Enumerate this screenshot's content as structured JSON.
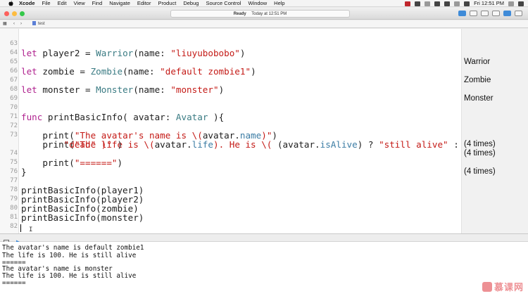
{
  "menubar": {
    "apple": "",
    "app": "Xcode",
    "items": [
      "File",
      "Edit",
      "View",
      "Find",
      "Navigate",
      "Editor",
      "Product",
      "Debug",
      "Source Control",
      "Window",
      "Help"
    ],
    "clock": "Fri 12:51 PM"
  },
  "toolbar": {
    "status_state": "Ready",
    "status_time": "Today at 12:51 PM"
  },
  "jumpbar": {
    "file": "test"
  },
  "editor": {
    "lines": [
      {
        "n": "63",
        "result": "Warrior"
      },
      {
        "n": "64",
        "result": ""
      },
      {
        "n": "65",
        "result": "Zombie"
      },
      {
        "n": "66",
        "result": ""
      },
      {
        "n": "67",
        "result": "Monster"
      },
      {
        "n": "68",
        "result": ""
      },
      {
        "n": "69",
        "result": ""
      },
      {
        "n": "70",
        "result": ""
      },
      {
        "n": "71",
        "result": ""
      },
      {
        "n": "72",
        "result": "(4 times)"
      },
      {
        "n": "73",
        "result": "(4 times)"
      },
      {
        "n": "74",
        "result": "(4 times)"
      },
      {
        "n": "75",
        "result": ""
      },
      {
        "n": "76",
        "result": ""
      },
      {
        "n": "77",
        "result": ""
      },
      {
        "n": "78",
        "result": ""
      },
      {
        "n": "79",
        "result": ""
      },
      {
        "n": "80",
        "result": ""
      },
      {
        "n": "81",
        "result": ""
      },
      {
        "n": "82",
        "result": ""
      },
      {
        "n": "83",
        "result": ""
      }
    ],
    "code": {
      "l63": [
        "let",
        " player2 = ",
        "Warrior",
        "(name: ",
        "\"liuyubobobo\"",
        ")"
      ],
      "l65": [
        "let",
        " zombie = ",
        "Zombie",
        "(name: ",
        "\"default zombie1\"",
        ")"
      ],
      "l67": [
        "let",
        " monster = ",
        "Monster",
        "(name: ",
        "\"monster\"",
        ")"
      ],
      "l70": [
        "func",
        " printBasicInfo( avatar: ",
        "Avatar",
        " ){"
      ],
      "l72": [
        "    print(",
        "\"The avatar's name is \\(",
        "avatar.",
        "name",
        ")\"",
        ")"
      ],
      "l73": [
        "    print(",
        "\"The life is \\(",
        "avatar.",
        "life",
        "). He is \\(",
        " (avatar.",
        "isAlive",
        ") ? ",
        "\"still alive\"",
        " :"
      ],
      "l73b": [
        "        ",
        "\"dead\"",
        " )\"",
        " )"
      ],
      "l74": [
        "    print(",
        "\"======\"",
        ")"
      ],
      "l75": "}",
      "l77": "printBasicInfo(player1)",
      "l78": "printBasicInfo(player2)",
      "l79": "printBasicInfo(zombie)",
      "l80": "printBasicInfo(monster)"
    },
    "results_extra": {
      "l73b": "(4 times)"
    }
  },
  "console": {
    "lines": [
      "The avatar's name is default zombie1",
      "The life is 100. He is still alive",
      "======",
      "The avatar's name is monster",
      "The life is 100. He is still alive",
      "======"
    ]
  },
  "watermark": {
    "text": "慕课网"
  },
  "colors": {
    "keyword": "#b0238f",
    "type": "#3a7b83",
    "string": "#c41a16",
    "property": "#3b7ca4",
    "close": "#fc605c",
    "minimize": "#fdbc40",
    "zoom": "#34c84a"
  }
}
